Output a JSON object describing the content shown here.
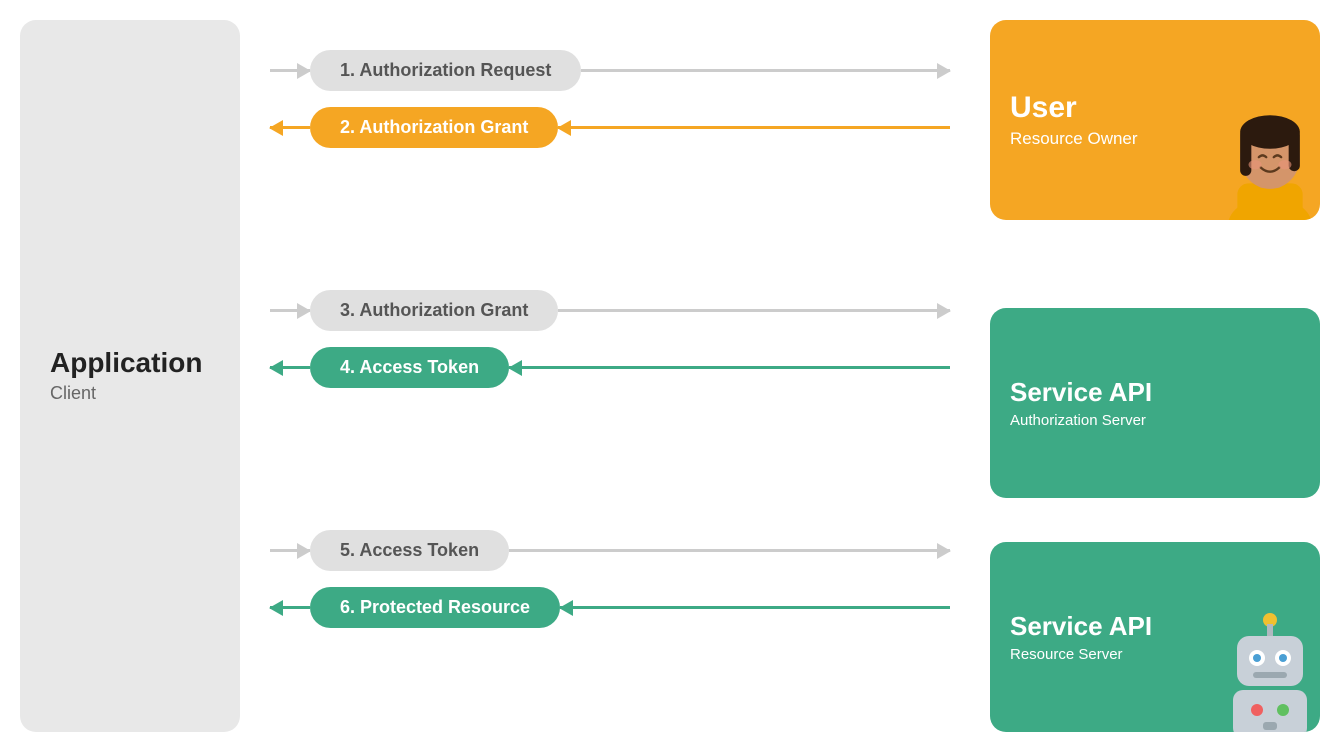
{
  "left_panel": {
    "title": "Application",
    "subtitle": "Client"
  },
  "user_box": {
    "title": "User",
    "subtitle": "Resource Owner"
  },
  "service_auth_box": {
    "title": "Service API",
    "subtitle": "Authorization Server"
  },
  "service_resource_box": {
    "title": "Service API",
    "subtitle": "Resource Server"
  },
  "arrows": {
    "step1_label": "1. Authorization Request",
    "step2_label": "2. Authorization Grant",
    "step3_label": "3. Authorization Grant",
    "step4_label": "4. Access Token",
    "step5_label": "5. Access Token",
    "step6_label": "6. Protected Resource"
  },
  "colors": {
    "orange": "#F5A623",
    "green": "#3DAA85",
    "gray_bg": "#e8e8e8",
    "gray_arrow": "#cccccc"
  }
}
